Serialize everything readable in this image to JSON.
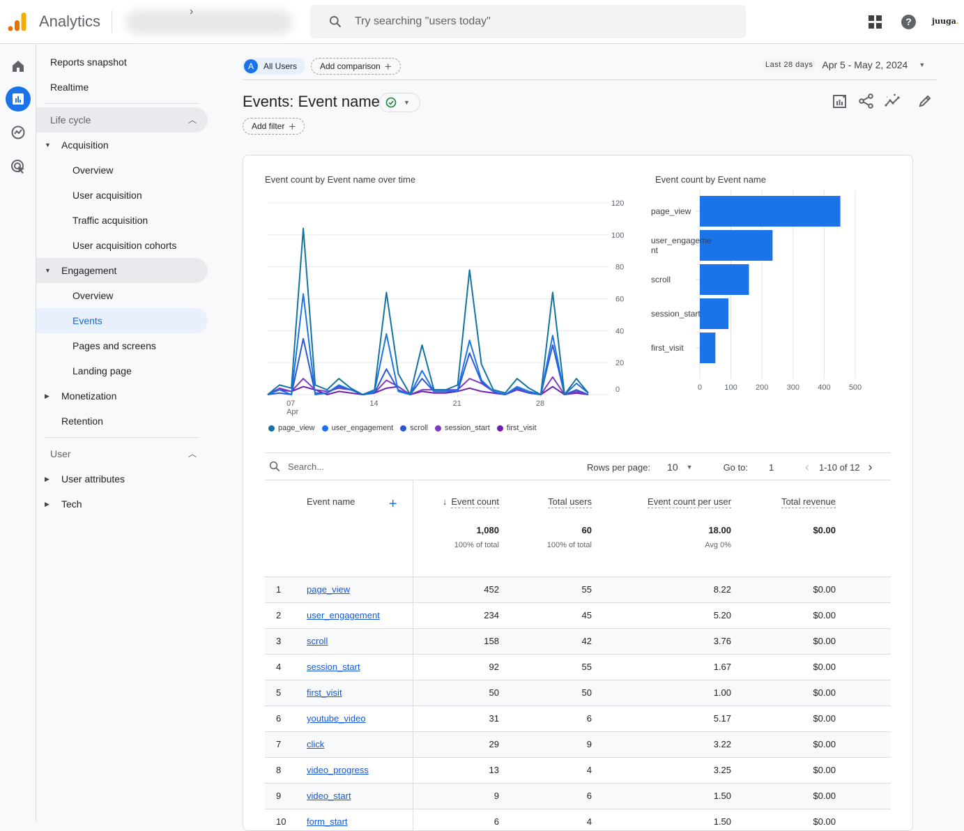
{
  "app": {
    "name": "Analytics",
    "brand": "juuga",
    "brand_dot": "."
  },
  "search": {
    "placeholder": "Try searching \"users today\""
  },
  "rail": [
    "home-icon",
    "reports-icon",
    "explore-icon",
    "advertising-icon"
  ],
  "nav": {
    "reports_snapshot": "Reports snapshot",
    "realtime": "Realtime",
    "lifecycle": "Life cycle",
    "acquisition": "Acquisition",
    "acq_overview": "Overview",
    "user_acquisition": "User acquisition",
    "traffic_acquisition": "Traffic acquisition",
    "user_acq_cohorts": "User acquisition cohorts",
    "engagement": "Engagement",
    "eng_overview": "Overview",
    "events": "Events",
    "pages_screens": "Pages and screens",
    "landing_page": "Landing page",
    "monetization": "Monetization",
    "retention": "Retention",
    "user": "User",
    "user_attributes": "User attributes",
    "tech": "Tech"
  },
  "comparison": {
    "avatar": "A",
    "segment": "All Users",
    "add": "Add comparison"
  },
  "date": {
    "label": "Last 28 days",
    "range": "Apr 5 - May 2, 2024"
  },
  "page": {
    "title": "Events: Event name",
    "add_filter": "Add filter"
  },
  "chart_data": [
    {
      "type": "line",
      "title": "Event count by Event name over time",
      "x": [
        "Apr 5",
        "Apr 6",
        "Apr 7",
        "Apr 8",
        "Apr 9",
        "Apr 10",
        "Apr 11",
        "Apr 12",
        "Apr 13",
        "Apr 14",
        "Apr 15",
        "Apr 16",
        "Apr 17",
        "Apr 18",
        "Apr 19",
        "Apr 20",
        "Apr 21",
        "Apr 22",
        "Apr 23",
        "Apr 24",
        "Apr 25",
        "Apr 26",
        "Apr 27",
        "Apr 28",
        "Apr 29",
        "Apr 30",
        "May 1",
        "May 2"
      ],
      "x_ticks": [
        {
          "label": "07",
          "sub": "Apr",
          "index": 2
        },
        {
          "label": "14",
          "index": 9
        },
        {
          "label": "21",
          "index": 16
        },
        {
          "label": "28",
          "index": 23
        }
      ],
      "y_ticks": [
        0,
        20,
        40,
        60,
        80,
        100,
        120
      ],
      "ylim": [
        0,
        120
      ],
      "grid": true,
      "legend": "bottom",
      "series": [
        {
          "name": "page_view",
          "color": "#12739f",
          "values": [
            0,
            6,
            4,
            104,
            6,
            3,
            10,
            4,
            0,
            3,
            64,
            13,
            0,
            31,
            3,
            3,
            6,
            78,
            19,
            3,
            1,
            10,
            4,
            0,
            64,
            0,
            10,
            1
          ]
        },
        {
          "name": "user_engagement",
          "color": "#1a73e8",
          "values": [
            0,
            3,
            0,
            63,
            0,
            1,
            6,
            3,
            0,
            2,
            38,
            2,
            0,
            15,
            2,
            2,
            3,
            34,
            9,
            2,
            0,
            5,
            2,
            0,
            37,
            0,
            7,
            1
          ]
        },
        {
          "name": "scroll",
          "color": "#2b56d6",
          "values": [
            0,
            1,
            0,
            35,
            1,
            1,
            5,
            3,
            0,
            1,
            16,
            3,
            0,
            10,
            2,
            2,
            2,
            26,
            8,
            2,
            0,
            4,
            1,
            0,
            31,
            0,
            3,
            0
          ]
        },
        {
          "name": "session_start",
          "color": "#7e3ac2",
          "values": [
            0,
            4,
            2,
            10,
            3,
            2,
            4,
            3,
            0,
            1,
            9,
            5,
            0,
            3,
            3,
            3,
            3,
            10,
            7,
            2,
            0,
            3,
            1,
            0,
            11,
            0,
            2,
            0
          ]
        },
        {
          "name": "first_visit",
          "color": "#6f1eb3",
          "values": [
            0,
            3,
            2,
            5,
            3,
            0,
            2,
            1,
            0,
            1,
            4,
            5,
            0,
            2,
            1,
            1,
            2,
            4,
            2,
            1,
            0,
            3,
            1,
            0,
            5,
            0,
            1,
            0
          ]
        }
      ]
    },
    {
      "type": "bar",
      "orientation": "horizontal",
      "title": "Event count by Event name",
      "categories": [
        "page_view",
        "user_engagement",
        "scroll",
        "session_start",
        "first_visit"
      ],
      "category_labels": [
        [
          "page_view"
        ],
        [
          "user_engageme",
          "nt"
        ],
        [
          "scroll"
        ],
        [
          "session_start"
        ],
        [
          "first_visit"
        ]
      ],
      "values": [
        452,
        234,
        158,
        92,
        50
      ],
      "x_ticks": [
        0,
        100,
        200,
        300,
        400,
        500
      ],
      "xlim": [
        0,
        500
      ],
      "color": "#1a73e8",
      "grid": true
    }
  ],
  "table": {
    "search_placeholder": "Search...",
    "rows_per_page_label": "Rows per page:",
    "rows_per_page": "10",
    "goto_label": "Go to:",
    "goto_value": "1",
    "range": "1-10 of 12",
    "headers": {
      "name": "Event name",
      "event_count": "Event count",
      "total_users": "Total users",
      "per_user": "Event count per user",
      "revenue": "Total revenue"
    },
    "totals": {
      "event_count": "1,080",
      "event_count_sub": "100% of total",
      "total_users": "60",
      "total_users_sub": "100% of total",
      "per_user": "18.00",
      "per_user_sub": "Avg 0%",
      "revenue": "$0.00"
    },
    "rows": [
      {
        "idx": "1",
        "name": "page_view",
        "count": "452",
        "users": "55",
        "per_user": "8.22",
        "revenue": "$0.00"
      },
      {
        "idx": "2",
        "name": "user_engagement",
        "count": "234",
        "users": "45",
        "per_user": "5.20",
        "revenue": "$0.00"
      },
      {
        "idx": "3",
        "name": "scroll",
        "count": "158",
        "users": "42",
        "per_user": "3.76",
        "revenue": "$0.00"
      },
      {
        "idx": "4",
        "name": "session_start",
        "count": "92",
        "users": "55",
        "per_user": "1.67",
        "revenue": "$0.00"
      },
      {
        "idx": "5",
        "name": "first_visit",
        "count": "50",
        "users": "50",
        "per_user": "1.00",
        "revenue": "$0.00"
      },
      {
        "idx": "6",
        "name": "youtube_video",
        "count": "31",
        "users": "6",
        "per_user": "5.17",
        "revenue": "$0.00"
      },
      {
        "idx": "7",
        "name": "click",
        "count": "29",
        "users": "9",
        "per_user": "3.22",
        "revenue": "$0.00"
      },
      {
        "idx": "8",
        "name": "video_progress",
        "count": "13",
        "users": "4",
        "per_user": "3.25",
        "revenue": "$0.00"
      },
      {
        "idx": "9",
        "name": "video_start",
        "count": "9",
        "users": "6",
        "per_user": "1.50",
        "revenue": "$0.00"
      },
      {
        "idx": "10",
        "name": "form_start",
        "count": "6",
        "users": "4",
        "per_user": "1.50",
        "revenue": "$0.00"
      }
    ]
  }
}
